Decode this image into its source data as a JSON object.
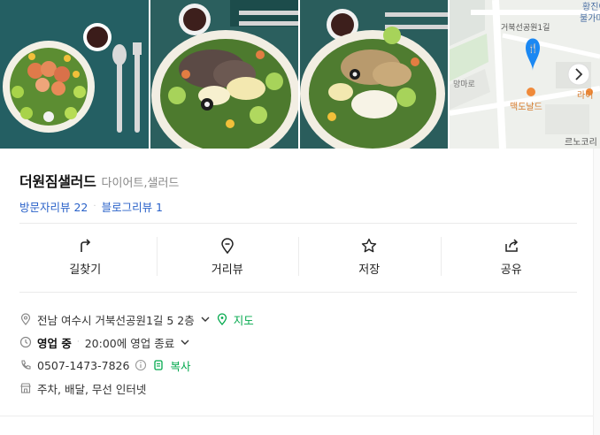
{
  "place": {
    "name": "더원짐샐러드",
    "category": "다이어트,샐러드",
    "visitor_reviews": "방문자리뷰 22",
    "blog_reviews": "블로그리뷰 1"
  },
  "map": {
    "labels": [
      "황진이",
      "불가마시",
      "거북선공원1길",
      "라이",
      "맥도날드",
      "르노코리",
      "망마로"
    ]
  },
  "actions": [
    {
      "label": "길찾기",
      "icon": "directions-icon"
    },
    {
      "label": "거리뷰",
      "icon": "street-view-icon"
    },
    {
      "label": "저장",
      "icon": "star-icon"
    },
    {
      "label": "공유",
      "icon": "share-icon"
    }
  ],
  "info": {
    "address": "전남 여수시 거북선공원1길 5 2층",
    "map_link": "지도",
    "status": "영업 중",
    "hours": "20:00에 영업 종료",
    "phone": "0507-1473-7826",
    "copy": "복사",
    "amenities": "주차, 배달, 무선 인터넷"
  },
  "colors": {
    "link_blue": "#2a62c9",
    "naver_green": "#03a94d",
    "map_pin": "#1b88f3"
  }
}
